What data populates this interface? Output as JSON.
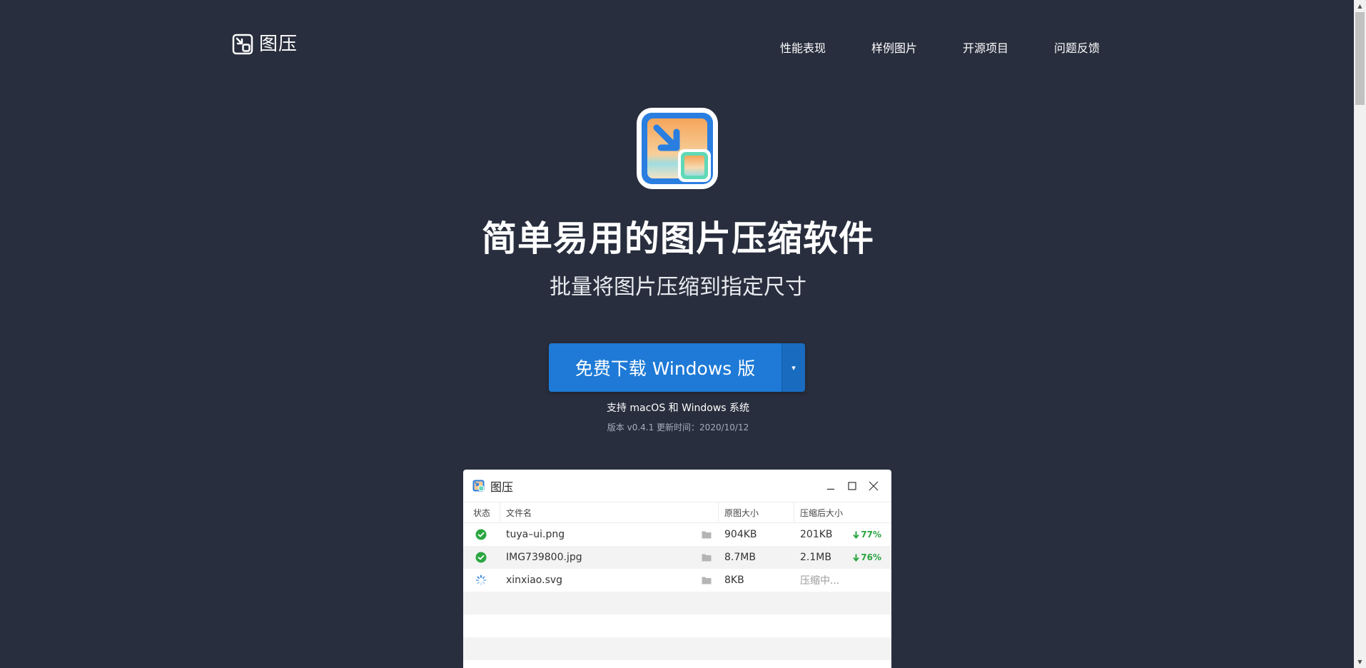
{
  "header": {
    "logo_text": "图压",
    "nav": [
      "性能表现",
      "样例图片",
      "开源项目",
      "问题反馈"
    ]
  },
  "hero": {
    "title": "简单易用的图片压缩软件",
    "subtitle": "批量将图片压缩到指定尺寸",
    "download_label": "免费下载 Windows 版",
    "dropdown_arrow": "▾",
    "support_text": "支持 macOS 和 Windows 系统",
    "version_text": "版本 v0.4.1 更新时间：2020/10/12"
  },
  "app_window": {
    "title": "图压",
    "columns": [
      "状态",
      "文件名",
      "原图大小",
      "压缩后大小"
    ],
    "rows": [
      {
        "status": "done",
        "name": "tuya–ui.png",
        "original": "904KB",
        "compressed": "201KB",
        "ratio": "77%"
      },
      {
        "status": "done",
        "name": "IMG739800.jpg",
        "original": "8.7MB",
        "compressed": "2.1MB",
        "ratio": "76%"
      },
      {
        "status": "loading",
        "name": "xinxiao.svg",
        "original": "8KB",
        "compressed": "压缩中..."
      }
    ]
  },
  "colors": {
    "background": "#282e3d",
    "accent": "#1e7ad6",
    "success": "#2aa641"
  }
}
